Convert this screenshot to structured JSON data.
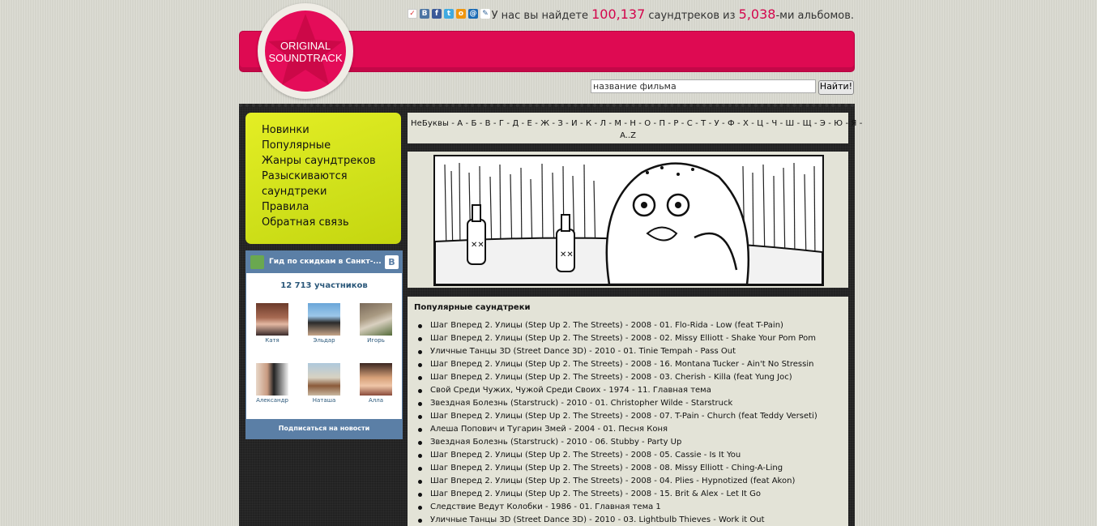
{
  "header": {
    "stats_prefix": "У нас вы найдете",
    "soundtracks_count": "100,137",
    "stats_middle": "саундтреков из",
    "albums_count": "5,038",
    "stats_suffix": "-ми альбомов.",
    "logo_line1": "ORIGINAL",
    "logo_line2": "SOUNDTRACK",
    "share_icons": [
      "bookmark-icon",
      "vk-icon",
      "facebook-icon",
      "twitter-icon",
      "odnoklassniki-icon",
      "mailru-icon",
      "livejournal-icon"
    ],
    "accent_color": "#de0a52"
  },
  "search": {
    "value": "название фильма",
    "button_label": "Найти!"
  },
  "nav": {
    "items": [
      "Новинки",
      "Популярные",
      "Жанры саундтреков",
      "Разыскиваются саундтреки",
      "Правила",
      "Обратная связь"
    ]
  },
  "vk_widget": {
    "group_name": "Гид по скидкам в Санкт-...",
    "vk_logo": "B",
    "members_count": "12 713 участников",
    "members": [
      "Катя",
      "Эльдар",
      "Игорь",
      "Александр",
      "Наташа",
      "Алла"
    ],
    "subscribe_label": "Подписаться на новости"
  },
  "alphabet": {
    "line1": "НеБуквы - А - Б - В - Г - Д - Е - Ж - З - И - К - Л - М - Н - О - П - Р - С - Т - У - Ф - Х - Ц - Ч - Ш - Щ - Э - Ю - Я -",
    "line2": "A..Z"
  },
  "popular": {
    "title": "Популярные саундтреки",
    "items": [
      "Шаг Вперед 2. Улицы (Step Up 2. The Streets) - 2008 - 01. Flo-Rida - Low (feat T-Pain)",
      "Шаг Вперед 2. Улицы (Step Up 2. The Streets) - 2008 - 02. Missy Elliott - Shake Your Pom Pom",
      "Уличные Танцы 3D (Street Dance 3D) - 2010 - 01. Tinie Tempah - Pass Out",
      "Шаг Вперед 2. Улицы (Step Up 2. The Streets) - 2008 - 16. Montana Tucker - Ain't No Stressin",
      "Шаг Вперед 2. Улицы (Step Up 2. The Streets) - 2008 - 03. Cherish - Killa (feat Yung Joc)",
      "Свой Среди Чужих, Чужой Среди Своих - 1974 - 11. Главная тема",
      "Звездная Болезнь (Starstruck) - 2010 - 01. Christopher Wilde - Starstruck",
      "Шаг Вперед 2. Улицы (Step Up 2. The Streets) - 2008 - 07. T-Pain - Church (feat Teddy Verseti)",
      "Алеша Попович и Тугарин Змей - 2004 - 01. Песня Коня",
      "Звездная Болезнь (Starstruck) - 2010 - 06. Stubby - Party Up",
      "Шаг Вперед 2. Улицы (Step Up 2. The Streets) - 2008 - 05. Cassie - Is It You",
      "Шаг Вперед 2. Улицы (Step Up 2. The Streets) - 2008 - 08. Missy Elliott - Ching-A-Ling",
      "Шаг Вперед 2. Улицы (Step Up 2. The Streets) - 2008 - 04. Plies - Hypnotized (feat Akon)",
      "Шаг Вперед 2. Улицы (Step Up 2. The Streets) - 2008 - 15. Brit & Alex - Let It Go",
      "Следствие Ведут Колобки - 1986 - 01. Главная тема 1",
      "Уличные Танцы 3D (Street Dance 3D) - 2010 - 03. Lightbulb Thieves - Work it Out"
    ]
  }
}
